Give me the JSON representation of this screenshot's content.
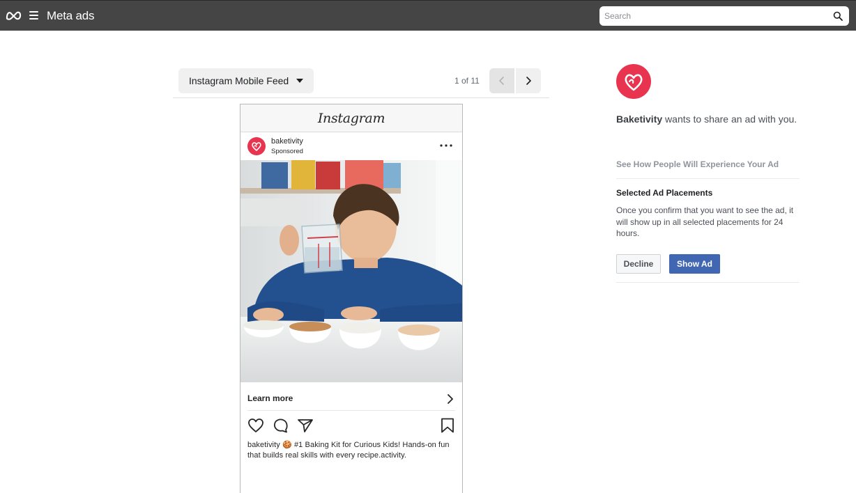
{
  "topbar": {
    "brand": "Meta ads",
    "search_placeholder": "Search",
    "icons": {
      "logo": "meta-logo-icon",
      "menu": "hamburger-icon",
      "search": "search-icon"
    }
  },
  "preview": {
    "placement": "Instagram Mobile Feed",
    "pager": "1 of 11"
  },
  "post": {
    "app_wordmark": "Instagram",
    "account": "baketivity",
    "sponsored": "Sponsored",
    "cta": "Learn more",
    "caption": "baketivity 🍪 #1 Baking Kit for Curious Kids! Hands-on fun that builds real skills with every recipe.activity."
  },
  "panel": {
    "advertiser": "Baketivity",
    "share_suffix": " wants to share an ad with you.",
    "see_how": "See How People Will Experience Your Ad",
    "placements_title": "Selected Ad Placements",
    "placements_desc": "Once you confirm that you want to see the ad, it will show up in all selected placements for 24 hours.",
    "decline": "Decline",
    "show_ad": "Show Ad"
  },
  "colors": {
    "topbar": "#454545",
    "brand_red": "#e8344e",
    "primary_button": "#4267b2"
  }
}
